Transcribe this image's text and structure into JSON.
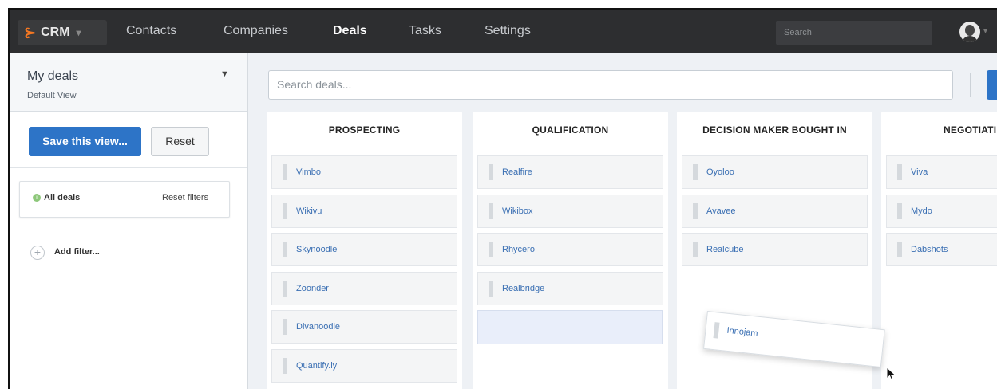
{
  "nav": {
    "brand": "CRM",
    "items": [
      "Contacts",
      "Companies",
      "Deals",
      "Tasks",
      "Settings"
    ],
    "active": "Deals",
    "search_placeholder": "Search"
  },
  "sidebar": {
    "view_title": "My deals",
    "view_subtitle": "Default View",
    "save_label": "Save this view...",
    "reset_label": "Reset",
    "filter_label": "All deals",
    "reset_filters_label": "Reset filters",
    "add_filter_label": "Add filter..."
  },
  "main": {
    "search_placeholder": "Search deals..."
  },
  "columns": [
    {
      "title": "PROSPECTING",
      "deals": [
        "Vimbo",
        "Wikivu",
        "Skynoodle",
        "Zoonder",
        "Divanoodle",
        "Quantify.ly"
      ]
    },
    {
      "title": "QUALIFICATION",
      "deals": [
        "Realfire",
        "Wikibox",
        "Rhycero",
        "Realbridge"
      ]
    },
    {
      "title": "DECISION MAKER BOUGHT IN",
      "deals": [
        "Oyoloo",
        "Avavee",
        "Realcube"
      ]
    },
    {
      "title": "NEGOTIATI",
      "deals": [
        "Viva",
        "Mydo",
        "Dabshots"
      ]
    }
  ],
  "dragging_deal": "Innojam",
  "colors": {
    "nav_bg": "#2d2e30",
    "accent": "#2d74c7",
    "brand_orange": "#f57722",
    "link": "#3a6fb3"
  }
}
